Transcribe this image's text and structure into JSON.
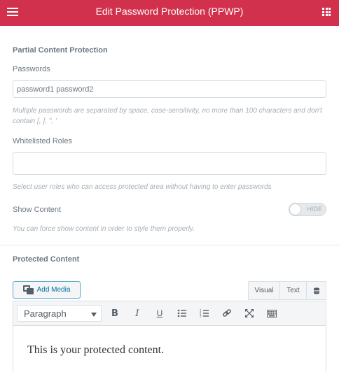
{
  "header": {
    "title": "Edit Password Protection (PPWP)",
    "menu_icon": "hamburger-menu-icon",
    "apps_icon": "apps-grid-icon",
    "background_color": "#d2314d"
  },
  "partial_content": {
    "section_title": "Partial Content Protection",
    "passwords": {
      "label": "Passwords",
      "value": "password1 password2",
      "description": "Multiple passwords are separated by space, case-sensitivity, no more than 100 characters and don't contain [, ], \", '"
    },
    "whitelisted_roles": {
      "label": "Whitelisted Roles",
      "value": "",
      "description": "Select user roles who can access protected area without having to enter passwords"
    },
    "show_content": {
      "label": "Show Content",
      "toggle_text": "HIDE",
      "enabled": false,
      "description": "You can force show content in order to style them properly."
    }
  },
  "protected_content": {
    "section_title": "Protected Content",
    "add_media_label": "Add Media",
    "tabs": [
      {
        "label": "Visual"
      },
      {
        "label": "Text"
      }
    ],
    "format_select": "Paragraph",
    "toolbar_icons": [
      "bold-icon",
      "italic-icon",
      "underline-icon",
      "bullet-list-icon",
      "numbered-list-icon",
      "link-icon",
      "fullscreen-icon",
      "toolbar-toggle-icon"
    ],
    "content": "This is your protected content."
  }
}
